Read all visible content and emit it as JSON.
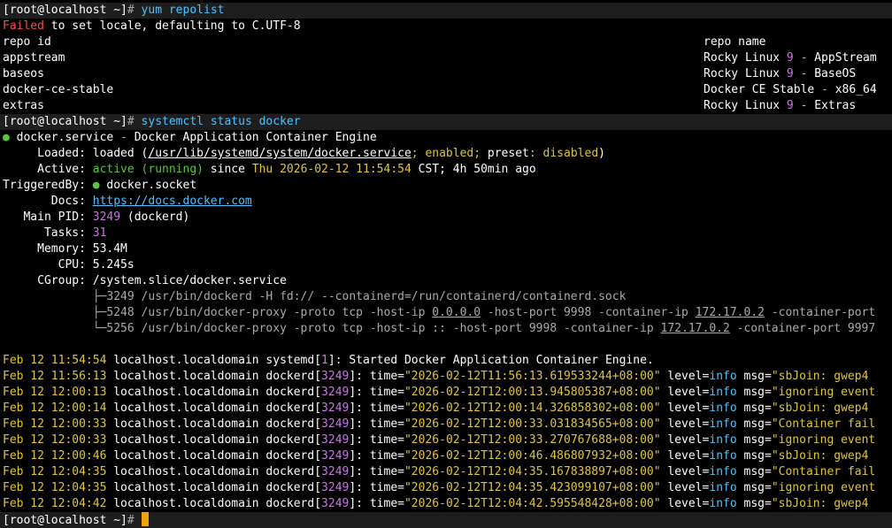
{
  "accent_colors": {
    "prompt_bg": "#1e1e1e",
    "error": "#f0524f",
    "active": "#5ac43a",
    "highlight": "#e0c53a",
    "command": "#4fc1ff",
    "number": "#c678dd",
    "cursor": "#f0a30a"
  },
  "session": {
    "prompt": "[root@localhost ~]",
    "hash": "#",
    "cmd1": "yum repolist",
    "cmd2": "systemctl status docker"
  },
  "repolist": {
    "failed": "Failed",
    "locale_msg": " to set locale, defaulting to C.UTF-8",
    "col_id": "repo id",
    "col_name": "repo name",
    "rows": [
      {
        "id": "appstream",
        "name_a": "Rocky Linux ",
        "num": "9",
        "dash": " - ",
        "name_b": "AppStream"
      },
      {
        "id": "baseos",
        "name_a": "Rocky Linux ",
        "num": "9",
        "dash": " - ",
        "name_b": "BaseOS"
      },
      {
        "id": "docker-ce-stable",
        "name_a": "Docker CE Stable",
        "num": "",
        "dash": " - ",
        "name_b": "x86_64"
      },
      {
        "id": "extras",
        "name_a": "Rocky Linux ",
        "num": "9",
        "dash": " - ",
        "name_b": "Extras"
      }
    ]
  },
  "status": {
    "bullet": "●",
    "unit": "docker.service",
    "dash": " - ",
    "description": "Docker Application Container Engine",
    "loaded_label": "     Loaded: ",
    "loaded_val": "loaded (",
    "loaded_path": "/usr/lib/systemd/system/docker.service",
    "loaded_sep1": "; ",
    "enabled": "enabled",
    "loaded_sep2": "; ",
    "preset_label": "preset",
    "preset_colon": ": ",
    "preset_val": "disabled",
    "loaded_close": ")",
    "active_label": "     Active: ",
    "active_val": "active (running)",
    "since": " since ",
    "since_date": "Thu 2026-02-12 11:54:54",
    "since_tail": " CST; 4h 50min ago",
    "triggered_label": "TriggeredBy: ",
    "triggered_val": "docker.socket",
    "docs_label": "       Docs: ",
    "docs_url": "https://docs.docker.com",
    "pid_label": "   Main PID: ",
    "pid": "3249",
    "pid_name": " (dockerd)",
    "tasks_label": "      Tasks: ",
    "tasks": "31",
    "memory_label": "     Memory: ",
    "memory": "53.4M",
    "cpu_label": "        CPU: ",
    "cpu": "5.245s",
    "cgroup_label": "     CGroup: ",
    "cgroup": "/system.slice/docker.service",
    "tree1_prefix": "             ├─",
    "tree1": "3249 /usr/bin/dockerd -H fd:// --containerd=/run/containerd/containerd.sock",
    "tree2_prefix": "             ├─",
    "tree2_a": "5248 /usr/bin/docker-proxy -proto tcp -host-ip ",
    "tree2_ip": "0.0.0.0",
    "tree2_b": " -host-port 9998 -container-ip ",
    "tree2_cip": "172.17.0.2",
    "tree2_c": " -container-port",
    "tree3_prefix": "             └─",
    "tree3_a": "5256 /usr/bin/docker-proxy -proto tcp -host-ip :: -host-port 9998 -container-ip ",
    "tree3_cip": "172.17.0.2",
    "tree3_c": " -container-port 9997"
  },
  "journal": {
    "first": {
      "ts": "Feb 12 11:54:54",
      "host": " localhost.localdomain systemd[",
      "pid": "1",
      "msg": "]: Started Docker Application Container Engine."
    },
    "host": " localhost.localdomain dockerd[",
    "pid": "3249",
    "sep": "]: time=",
    "level_label": "level=",
    "level_val": "info",
    "msg_label": " msg=",
    "rows": [
      {
        "ts": "Feb 12 11:56:13",
        "time": "\"2026-02-12T11:56:13.619533244+08:00\"",
        "msg": "\"sbJoin: gwep4"
      },
      {
        "ts": "Feb 12 12:00:13",
        "time": "\"2026-02-12T12:00:13.945805387+08:00\"",
        "msg": "\"ignoring event"
      },
      {
        "ts": "Feb 12 12:00:14",
        "time": "\"2026-02-12T12:00:14.326858302+08:00\"",
        "msg": "\"sbJoin: gwep4"
      },
      {
        "ts": "Feb 12 12:00:33",
        "time": "\"2026-02-12T12:00:33.031834565+08:00\"",
        "msg": "\"Container fail"
      },
      {
        "ts": "Feb 12 12:00:33",
        "time": "\"2026-02-12T12:00:33.270767688+08:00\"",
        "msg": "\"ignoring event"
      },
      {
        "ts": "Feb 12 12:00:46",
        "time": "\"2026-02-12T12:00:46.486807932+08:00\"",
        "msg": "\"sbJoin: gwep4"
      },
      {
        "ts": "Feb 12 12:04:35",
        "time": "\"2026-02-12T12:04:35.167838897+08:00\"",
        "msg": "\"Container fail"
      },
      {
        "ts": "Feb 12 12:04:35",
        "time": "\"2026-02-12T12:04:35.423099107+08:00\"",
        "msg": "\"ignoring event"
      },
      {
        "ts": "Feb 12 12:04:42",
        "time": "\"2026-02-12T12:04:42.595548428+08:00\"",
        "msg": "\"sbJoin: gwep4"
      }
    ]
  }
}
